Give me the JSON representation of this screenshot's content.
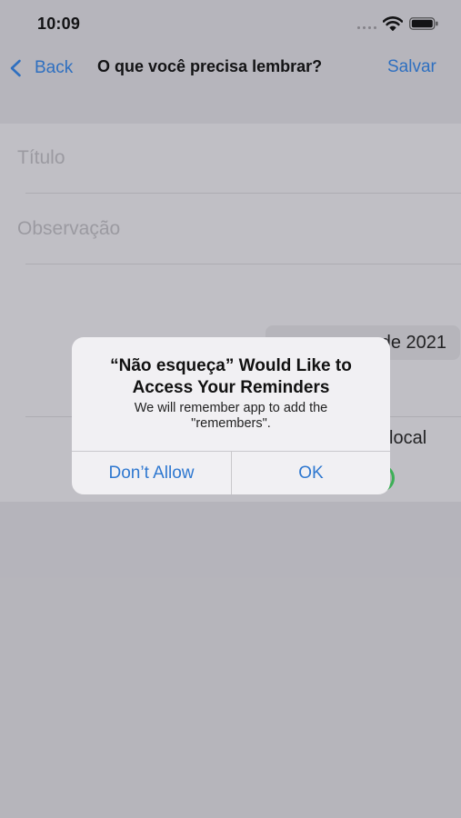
{
  "status_bar": {
    "time": "10:09"
  },
  "nav": {
    "back_label": "Back",
    "title": "O que você precisa lembrar?",
    "save_label": "Salvar"
  },
  "form": {
    "title_placeholder": "Título",
    "notes_placeholder": "Observação",
    "date_text": "de 2021",
    "location_label": "local"
  },
  "alert": {
    "title": "“Não esqueça” Would Like to Access Your Reminders",
    "message": "We will remember app to add the \"remembers\".",
    "dont_allow_label": "Don’t Allow",
    "ok_label": "OK"
  },
  "colors": {
    "accent": "#2f78d0",
    "toggle_on": "#3fbf5a"
  },
  "icons": [
    "signal-dots-icon",
    "wifi-icon",
    "battery-icon",
    "chevron-left-icon"
  ]
}
